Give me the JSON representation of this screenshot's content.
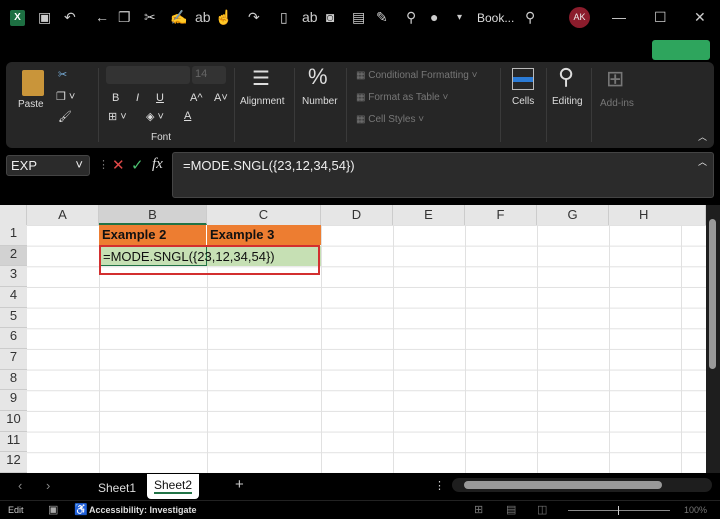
{
  "titlebar": {
    "title": "Book...",
    "avatar": "AK",
    "app_icon": "X"
  },
  "ribbon": {
    "clipboard": {
      "paste": "Paste"
    },
    "font": {
      "size": "14",
      "bold": "B",
      "italic": "I",
      "underline": "U",
      "grow": "A^",
      "shrink": "A˅",
      "label": "Font"
    },
    "alignment": "Alignment",
    "number": "Number",
    "number_symbol": "%",
    "styles": {
      "conditional": "Conditional Formatting",
      "table": "Format as Table",
      "cell_styles": "Cell Styles"
    },
    "cells": "Cells",
    "editing": "Editing",
    "addins": "Add-ins"
  },
  "formula_bar": {
    "name_box": "EXP",
    "cancel": "✕",
    "enter": "✓",
    "fx": "fx",
    "formula": "=MODE.SNGL({23,12,34,54})"
  },
  "columns": [
    "A",
    "B",
    "C",
    "D",
    "E",
    "F",
    "G",
    "H"
  ],
  "rows": [
    "1",
    "2",
    "3",
    "4",
    "5",
    "6",
    "7",
    "8",
    "9",
    "10",
    "11",
    "12"
  ],
  "cells": {
    "B1": "Example 2",
    "C1": "Example 3",
    "B2": "=MODE.SNGL({23,12,34,54})"
  },
  "colors": {
    "header_fill": "#ed7d31",
    "input_fill": "#c6e0b4",
    "highlight_border": "#d32f2f",
    "accent": "#217346"
  },
  "sheets": {
    "tabs": [
      "Sheet1",
      "Sheet2"
    ],
    "active": "Sheet2",
    "add": "+"
  },
  "status": {
    "mode": "Edit",
    "accessibility": "Accessibility: Investigate",
    "zoom": "100%"
  }
}
